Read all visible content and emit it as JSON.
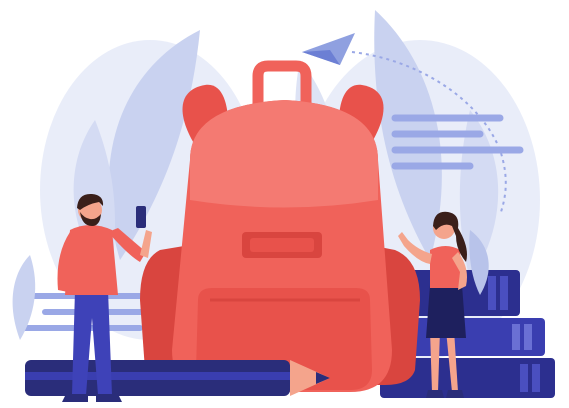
{
  "scene": {
    "subject": "school-backpack-illustration",
    "colors": {
      "background": "#ffffff",
      "backpack": "#f0625a",
      "backpack_dark": "#d9453f",
      "backpack_light": "#f47a72",
      "leaf_pale": "#dde3f5",
      "leaf_mid": "#b8c3ea",
      "stripe": "#9aa8e6",
      "book_navy": "#2c2f8f",
      "book_blue": "#4a4fc0",
      "pencil_dark": "#2a2d7a",
      "person_shirt": "#f0625a",
      "person_pants": "#3e42b8",
      "skin": "#f4a48c",
      "hair": "#3a1f1a"
    },
    "icons": [
      "paper-plane-icon",
      "phone-icon"
    ]
  }
}
